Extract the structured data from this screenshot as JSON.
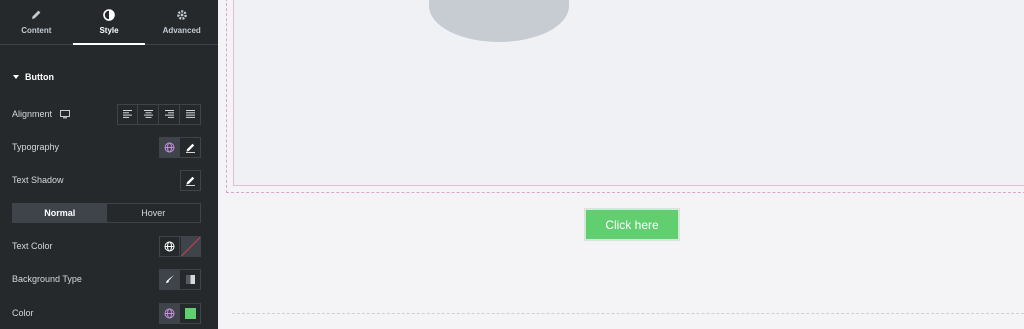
{
  "tabs": [
    {
      "label": "Content",
      "icon": "pencil-icon"
    },
    {
      "label": "Style",
      "icon": "half-circle-icon"
    },
    {
      "label": "Advanced",
      "icon": "gear-icon"
    }
  ],
  "section": {
    "title": "Button"
  },
  "controls": {
    "alignment": {
      "label": "Alignment",
      "options": [
        "align-left",
        "align-center",
        "align-right",
        "align-justify"
      ]
    },
    "typography": {
      "label": "Typography"
    },
    "text_shadow": {
      "label": "Text Shadow"
    },
    "state_tabs": [
      "Normal",
      "Hover"
    ],
    "text_color": {
      "label": "Text Color"
    },
    "background_type": {
      "label": "Background Type"
    },
    "color": {
      "label": "Color",
      "value": "#61ce70"
    }
  },
  "preview": {
    "button_label": "Click here"
  },
  "colors": {
    "panel_bg": "#26292c",
    "accent_green": "#61ce70",
    "border": "#3f444b"
  }
}
